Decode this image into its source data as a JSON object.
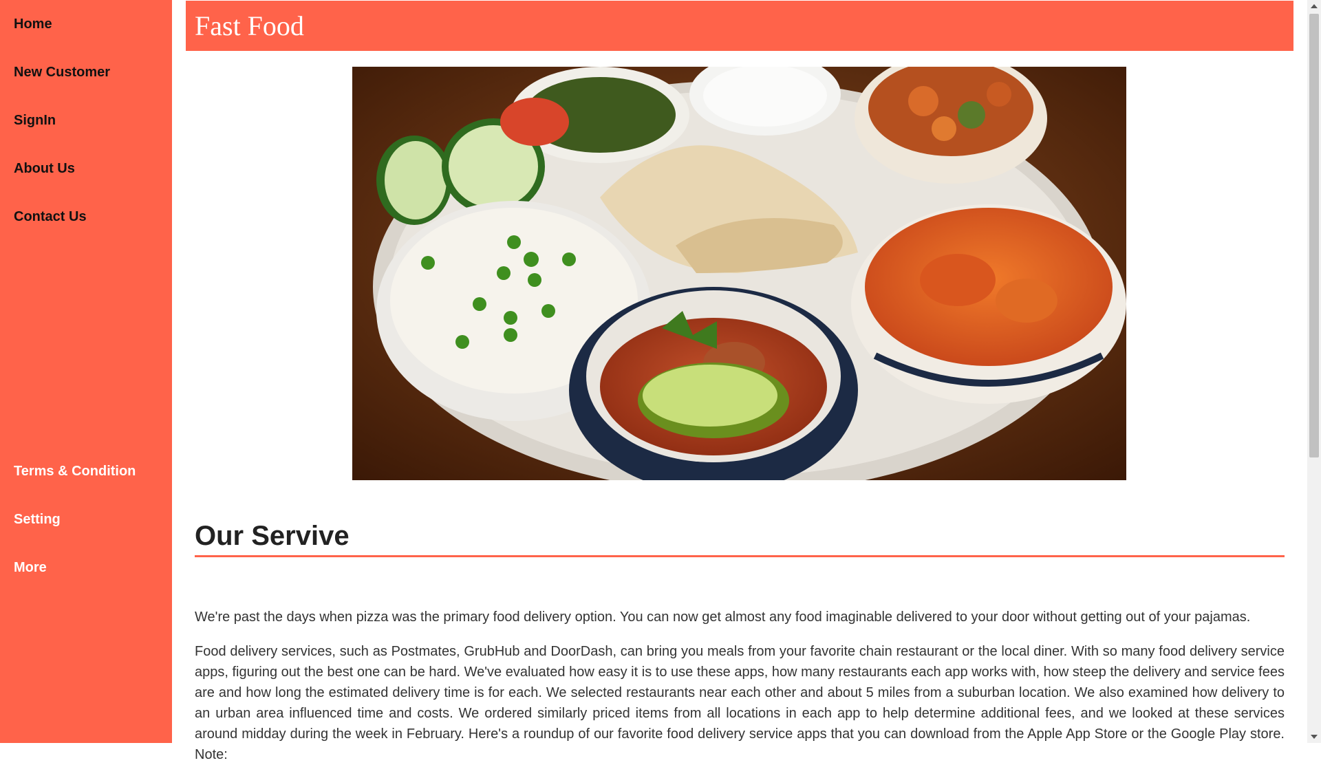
{
  "sidebar": {
    "top_items": [
      {
        "label": "Home"
      },
      {
        "label": "New Customer"
      },
      {
        "label": "SignIn"
      },
      {
        "label": "About Us"
      },
      {
        "label": "Contact Us"
      }
    ],
    "bottom_items": [
      {
        "label": "Terms & Condition"
      },
      {
        "label": "Setting"
      },
      {
        "label": "More"
      }
    ]
  },
  "header": {
    "title": "Fast Food"
  },
  "hero": {
    "image_name": "indian-thali-food-photo"
  },
  "section": {
    "title": "Our Servive",
    "paragraphs": [
      "We're past the days when pizza was the primary food delivery option. You can now get almost any food imaginable delivered to your door without getting out of your pajamas.",
      "Food delivery services, such as Postmates, GrubHub and DoorDash, can bring you meals from your favorite chain restaurant or the local diner. With so many food delivery service apps, figuring out the best one can be hard. We've evaluated how easy it is to use these apps, how many restaurants each app works with, how steep the delivery and service fees are and how long the estimated delivery time is for each. We selected restaurants near each other and about 5 miles from a suburban location. We also examined how delivery to an urban area influenced time and costs. We ordered similarly priced items from all locations in each app to help determine additional fees, and we looked at these services around midday during the week in February. Here's a roundup of our favorite food delivery service apps that you can download from the Apple App Store or the Google Play store. Note:"
    ]
  },
  "colors": {
    "accent": "#ff634a",
    "text": "#333333"
  }
}
